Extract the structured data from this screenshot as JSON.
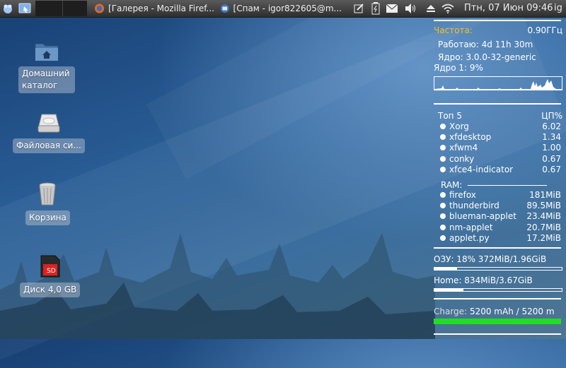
{
  "panel": {
    "tasks": [
      {
        "title": "[Галерея - Mozilla Firef...",
        "icon": "firefox-icon"
      },
      {
        "title": "[Спам - igor822605@m...",
        "icon": "thunderbird-icon"
      }
    ],
    "clock": "Птн, 07 Июн  09:46",
    "user": "ig"
  },
  "desktop": {
    "icons": [
      {
        "label": "Домашний\nкаталог",
        "icon": "home-folder-icon"
      },
      {
        "label": "Файловая си...",
        "icon": "drive-icon"
      },
      {
        "label": "Корзина",
        "icon": "trash-icon"
      },
      {
        "label": "Диск 4,0 GB",
        "icon": "sd-card-icon"
      }
    ]
  },
  "conky": {
    "freq_label": "Частота:",
    "freq_value": "0.90ГГц",
    "uptime": "Работаю: 4d 11h 30m",
    "kernel": "Ядро: 3.0.0-32-generic",
    "core1": "Ядро 1: 9%",
    "top_header": "Топ  5",
    "cpu_header": "ЦП%",
    "top_cpu": [
      {
        "name": "Xorg",
        "value": "6.02"
      },
      {
        "name": "xfdesktop",
        "value": "1.34"
      },
      {
        "name": "xfwm4",
        "value": "1.00"
      },
      {
        "name": "conky",
        "value": "0.67"
      },
      {
        "name": "xfce4-indicator",
        "value": "0.67"
      }
    ],
    "ram_header": "RAM:",
    "top_ram": [
      {
        "name": "firefox",
        "value": "181MiB"
      },
      {
        "name": "thunderbird",
        "value": "89.5MiB"
      },
      {
        "name": "blueman-applet",
        "value": "23.4MiB"
      },
      {
        "name": "nm-applet",
        "value": "20.7MiB"
      },
      {
        "name": "applet.py",
        "value": "17.2MiB"
      }
    ],
    "ozu": "ОЗУ:   18% 372MiB/1.96GiB",
    "ozu_fraction": 0.18,
    "home": "Home:      834MiB/3.67GiB",
    "home_fraction": 0.23,
    "charge_label": "Charge:",
    "charge_value": "5200 mAh / 5200 m",
    "charge_fraction": 1.0,
    "colors": {
      "freq_label": "#f0c020",
      "charge_label": "#dddddd",
      "charge_bar": "#22dd22"
    }
  }
}
